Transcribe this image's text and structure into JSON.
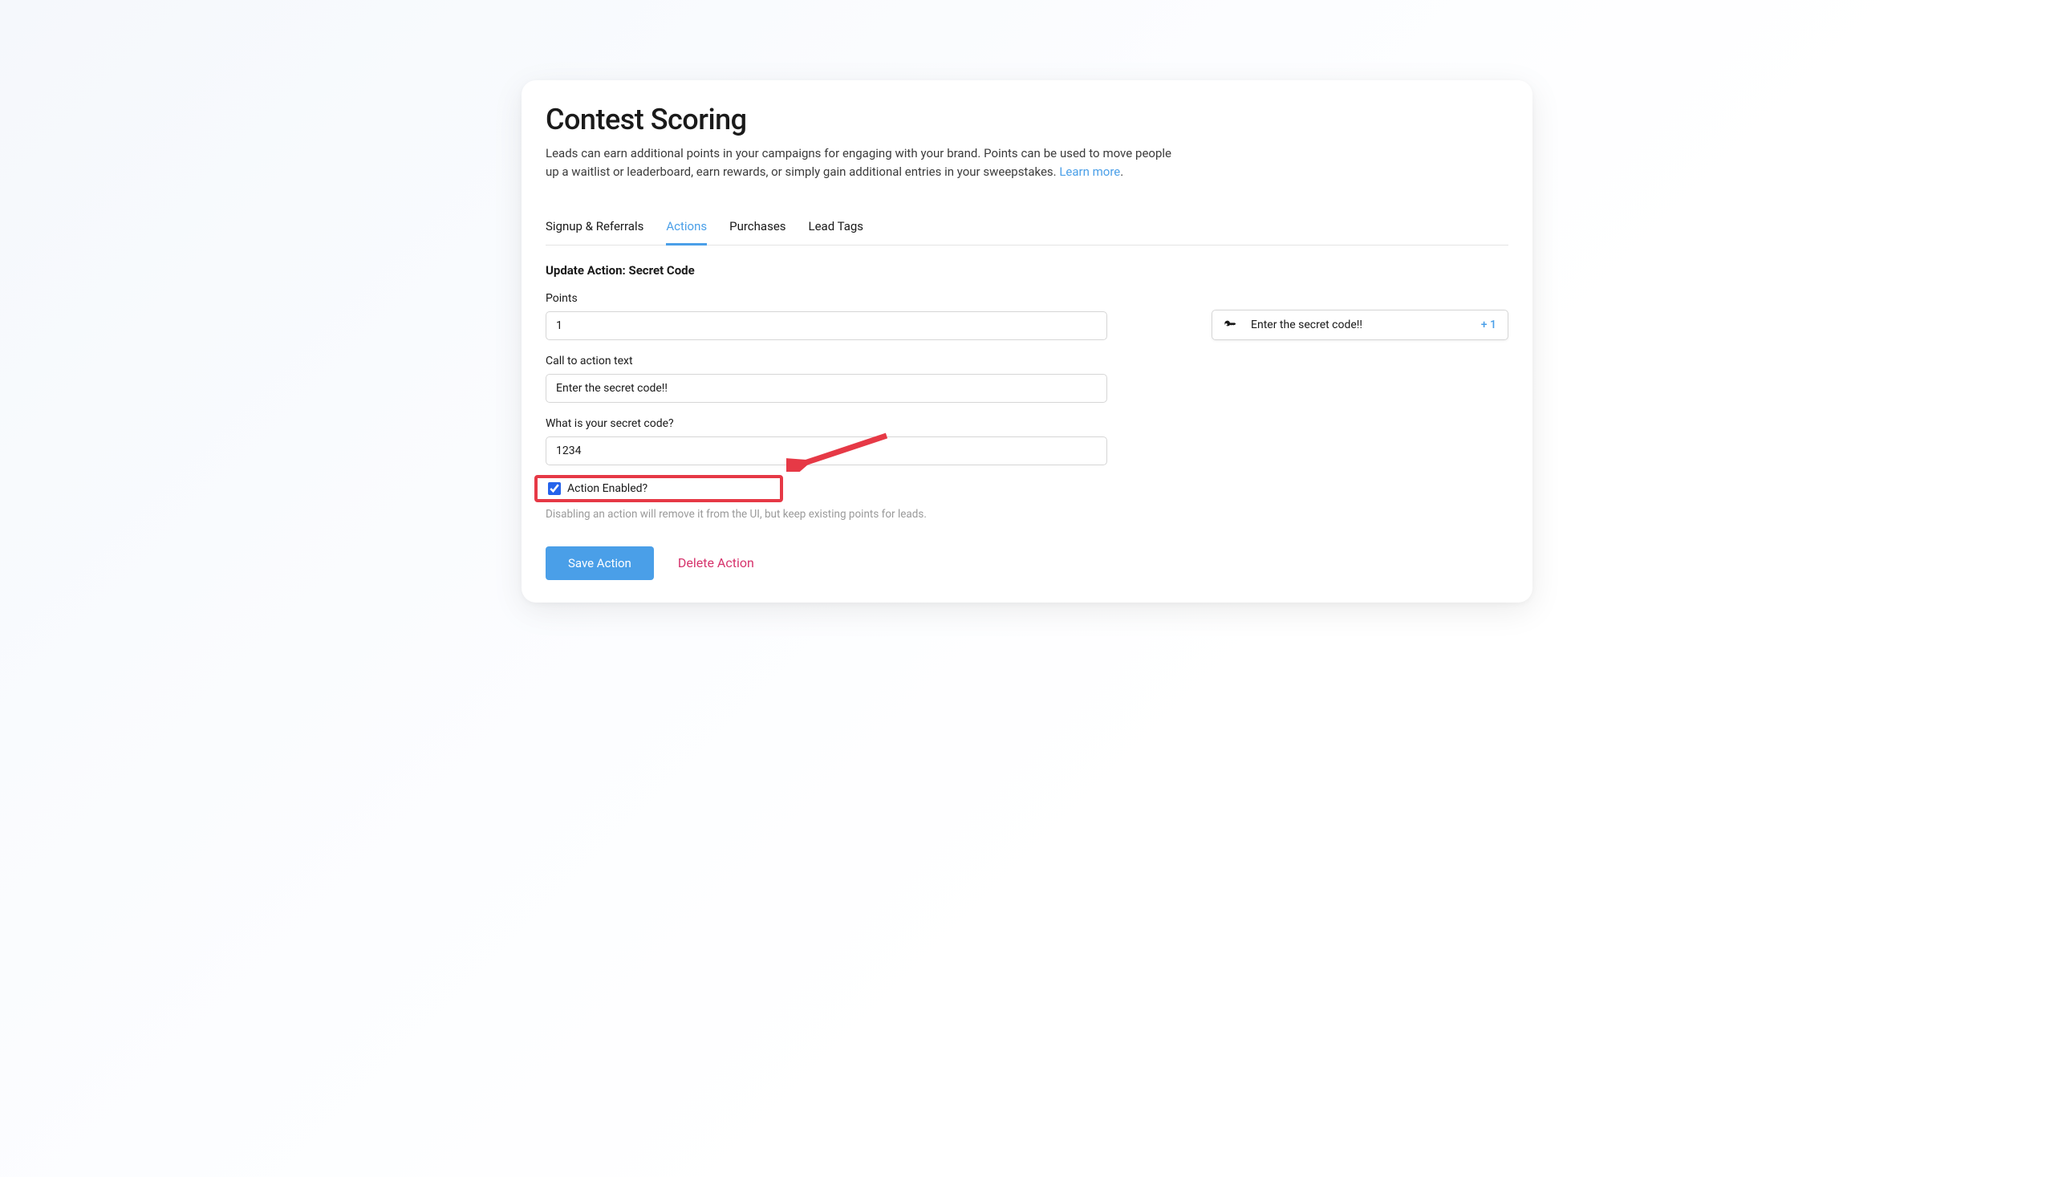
{
  "header": {
    "title": "Contest Scoring",
    "description_before_link": "Leads can earn additional points in your campaigns for engaging with your brand. Points can be used to move people up a waitlist or leaderboard, earn rewards, or simply gain additional entries in your sweepstakes. ",
    "learn_more": "Learn more",
    "description_after_link": "."
  },
  "tabs": [
    {
      "label": "Signup & Referrals",
      "active": false
    },
    {
      "label": "Actions",
      "active": true
    },
    {
      "label": "Purchases",
      "active": false
    },
    {
      "label": "Lead Tags",
      "active": false
    }
  ],
  "form": {
    "section_title": "Update Action: Secret Code",
    "points_label": "Points",
    "points_value": "1",
    "cta_label": "Call to action text",
    "cta_value": "Enter the secret code!!",
    "secret_label": "What is your secret code?",
    "secret_value": "1234",
    "enabled_label": "Action Enabled?",
    "enabled_checked": true,
    "help_text": "Disabling an action will remove it from the UI, but keep existing points for leads.",
    "save_label": "Save Action",
    "delete_label": "Delete Action"
  },
  "preview": {
    "icon_name": "key-icon",
    "text": "Enter the secret code!!",
    "points": "+ 1"
  },
  "colors": {
    "accent": "#4a9fe8",
    "danger": "#d6336c",
    "highlight": "#e63946"
  }
}
